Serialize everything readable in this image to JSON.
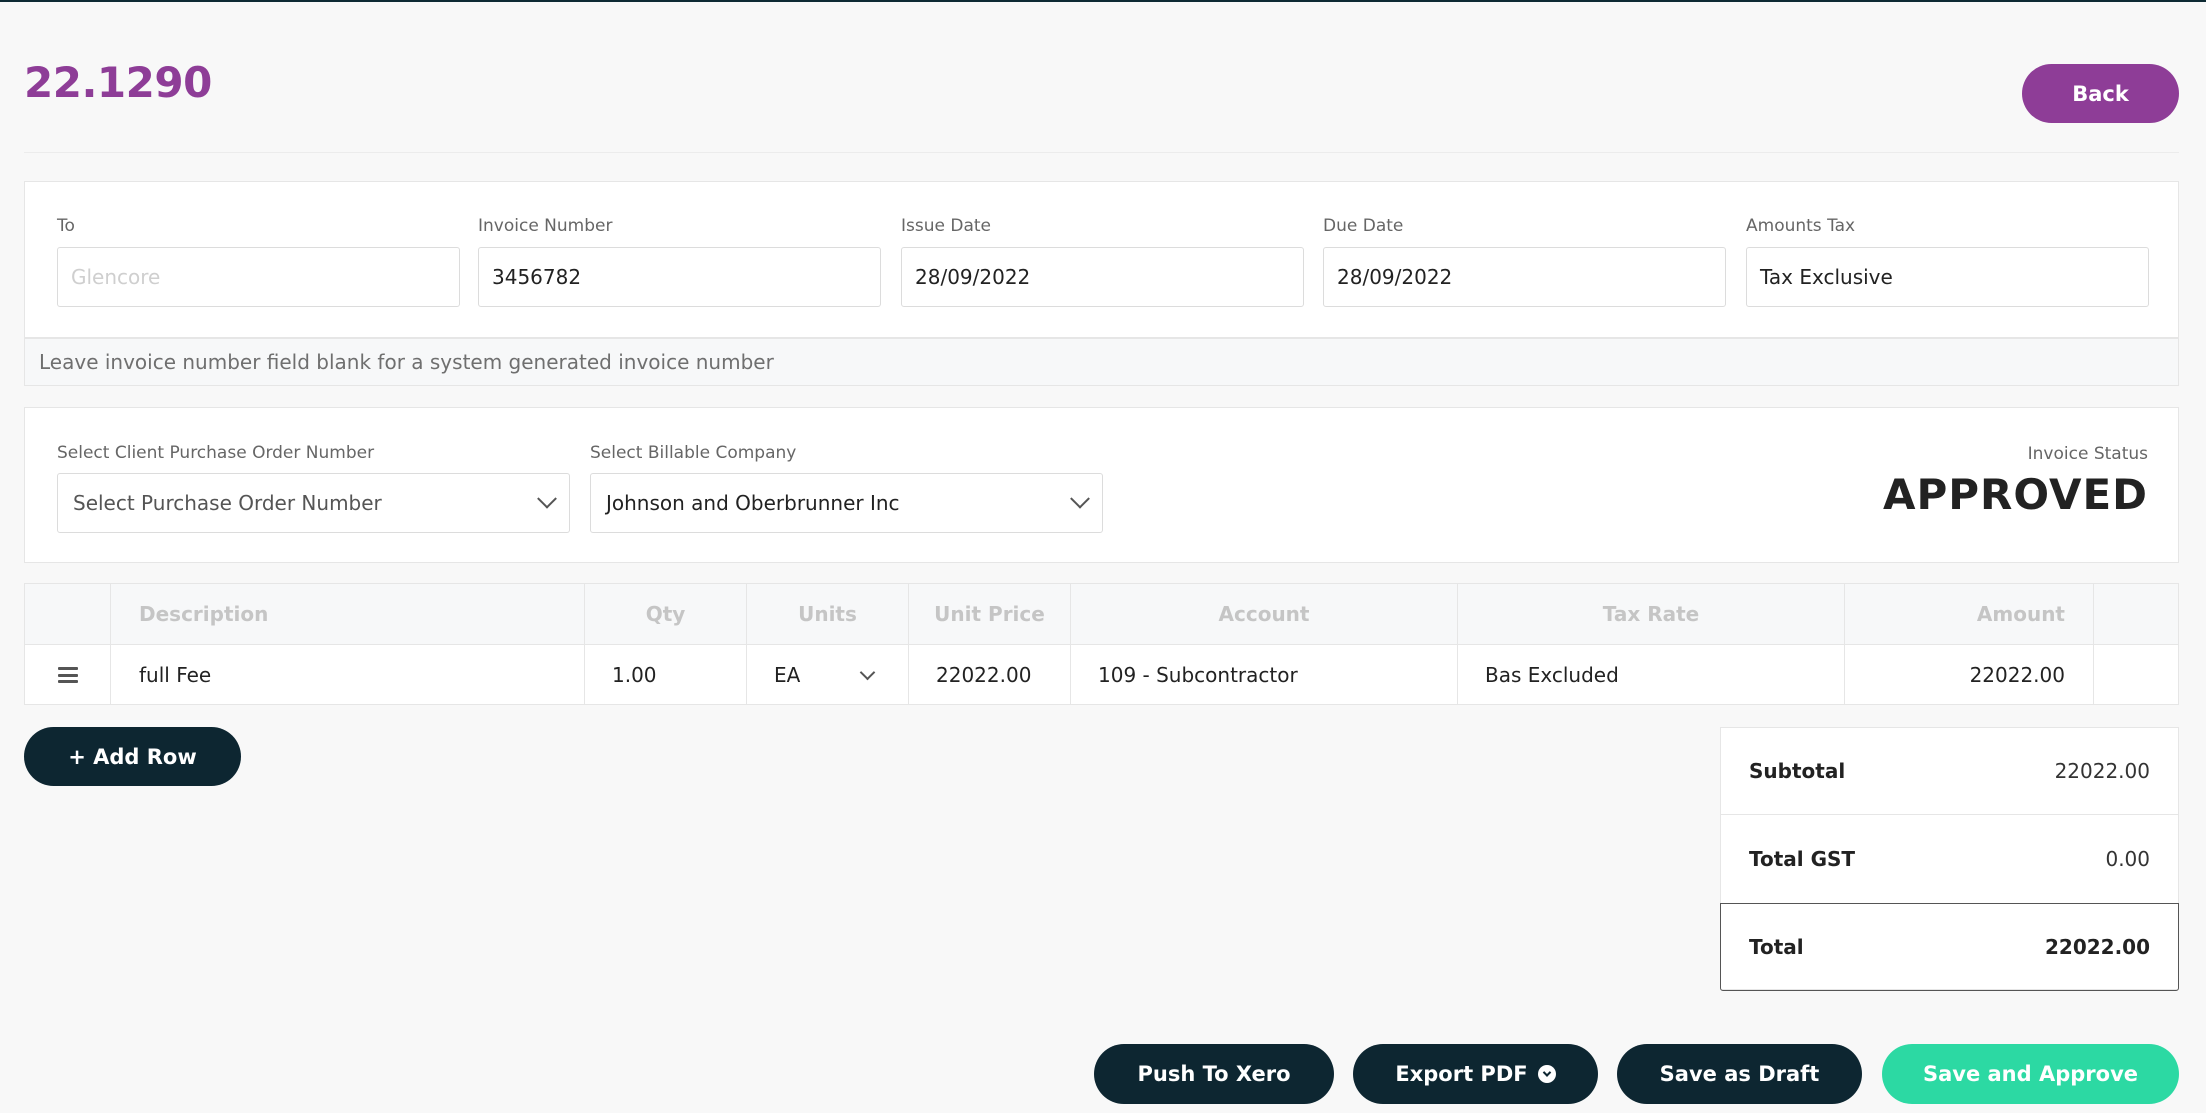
{
  "header": {
    "title": "22.1290",
    "back_label": "Back"
  },
  "invoice_fields": {
    "to": {
      "label": "To",
      "placeholder": "Glencore"
    },
    "invoice_number": {
      "label": "Invoice Number",
      "value": "3456782"
    },
    "issue_date": {
      "label": "Issue Date",
      "value": "28/09/2022"
    },
    "due_date": {
      "label": "Due Date",
      "value": "28/09/2022"
    },
    "amounts_tax": {
      "label": "Amounts Tax",
      "value": "Tax Exclusive"
    }
  },
  "hint": "Leave invoice number field blank for a system generated invoice number",
  "selects": {
    "purchase_order": {
      "label": "Select Client Purchase Order Number",
      "value": "Select Purchase Order Number"
    },
    "billable_company": {
      "label": "Select Billable Company",
      "value": "Johnson and Oberbrunner Inc"
    }
  },
  "status": {
    "label": "Invoice Status",
    "value": "APPROVED"
  },
  "table": {
    "headers": [
      "Description",
      "Qty",
      "Units",
      "Unit Price",
      "Account",
      "Tax Rate",
      "Amount"
    ],
    "rows": [
      {
        "description": "full Fee",
        "qty": "1.00",
        "units": "EA",
        "unit_price": "22022.00",
        "account": "109 - Subcontractor",
        "tax_rate": "Bas Excluded",
        "amount": "22022.00"
      }
    ]
  },
  "add_row_label": "+ Add Row",
  "totals": {
    "subtotal_label": "Subtotal",
    "subtotal_value": "22022.00",
    "gst_label": "Total GST",
    "gst_value": "0.00",
    "total_label": "Total",
    "total_value": "22022.00"
  },
  "actions": {
    "push_xero": "Push To Xero",
    "export_pdf": "Export PDF",
    "save_draft": "Save as Draft",
    "save_approve": "Save and Approve"
  },
  "colors": {
    "brand_purple": "#8e3d97",
    "dark_navy": "#0d2631",
    "approve_green": "#2cd9a3"
  }
}
